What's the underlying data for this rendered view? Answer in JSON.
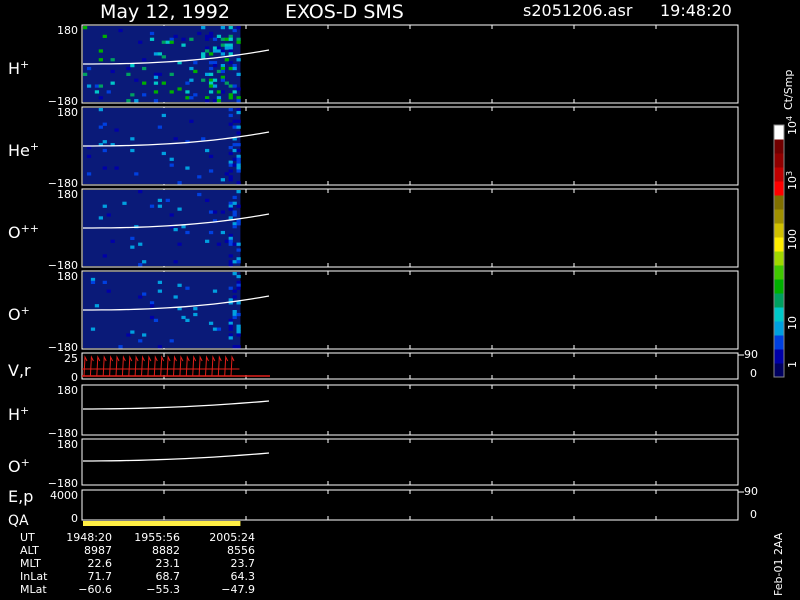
{
  "header": {
    "date": "May 12, 1992",
    "instrument": "EXOS-D SMS",
    "file": "s2051206.asr",
    "time": "19:48:20"
  },
  "colors": {
    "background": "#000000",
    "spectrogram_background": "#0a1a78",
    "trace": "#ffffff",
    "velocity": "#e0201a",
    "qa_bar": "#ffee44",
    "axis": "#ffffff"
  },
  "colorbar": {
    "unit": "Ct/Smp",
    "tick_labels": [
      "1",
      "10",
      "100",
      "10",
      "10",
      "10"
    ],
    "tick_exponents": [
      "",
      "",
      "",
      "3",
      "4",
      ""
    ],
    "colors": [
      "#000060",
      "#0000a8",
      "#0040e0",
      "#00a0e0",
      "#00c8c8",
      "#00a060",
      "#00b000",
      "#40c800",
      "#a0d800",
      "#ffee00",
      "#d0c000",
      "#a09000",
      "#807000",
      "#ff0000",
      "#c00000",
      "#900000",
      "#700000",
      "#ffffff"
    ]
  },
  "panels": [
    {
      "id": "H+",
      "label": "H",
      "sup": "+",
      "ymax": "180",
      "ymin": "−180"
    },
    {
      "id": "He+",
      "label": "He",
      "sup": "+",
      "ymax": "180",
      "ymin": "−180"
    },
    {
      "id": "O++",
      "label": "O",
      "sup": "++",
      "ymax": "180",
      "ymin": "−180"
    },
    {
      "id": "O+",
      "label": "O",
      "sup": "+",
      "ymax": "180",
      "ymin": "−180"
    },
    {
      "id": "Vr",
      "label": "V,r",
      "sup": "",
      "ymax": "25",
      "ymin": "0",
      "right_top": "90",
      "right_bottom": "0"
    },
    {
      "id": "H+2",
      "label": "H",
      "sup": "+",
      "ymax": "180",
      "ymin": "−180"
    },
    {
      "id": "O+2",
      "label": "O",
      "sup": "+",
      "ymax": "180",
      "ymin": "−180"
    },
    {
      "id": "Ep",
      "label": "E,p",
      "label2": "QA",
      "sup": "",
      "ymax": "4000",
      "ymin": "0",
      "right_top": "90",
      "right_bottom": "0"
    }
  ],
  "time_table": {
    "rows": [
      {
        "name": "UT",
        "values": [
          "1948:20",
          "1955:56",
          "2005:24"
        ]
      },
      {
        "name": "ALT",
        "values": [
          "8987",
          "8882",
          "8556"
        ]
      },
      {
        "name": "MLT",
        "values": [
          "22.6",
          "23.1",
          "23.7"
        ]
      },
      {
        "name": "InLat",
        "values": [
          "71.7",
          "68.7",
          "64.3"
        ]
      },
      {
        "name": "MLat",
        "values": [
          "−60.6",
          "−55.3",
          "−47.9"
        ]
      }
    ]
  },
  "footer_note": "Feb-01 2AA",
  "chart_data": {
    "type": "heatmap",
    "title": "May 12, 1992   EXOS-D SMS",
    "x_labels": [
      "1948:20",
      "1955:56",
      "2005:24"
    ],
    "ylim_pitch": [
      -180,
      180
    ],
    "series": [
      {
        "name": "H+",
        "data_extent_fraction": 0.24
      },
      {
        "name": "He+",
        "data_extent_fraction": 0.24
      },
      {
        "name": "O++",
        "data_extent_fraction": 0.24
      },
      {
        "name": "O+",
        "data_extent_fraction": 0.24
      }
    ],
    "colorbar_range": [
      1,
      10000
    ],
    "qa_extent_fraction": 0.24
  }
}
